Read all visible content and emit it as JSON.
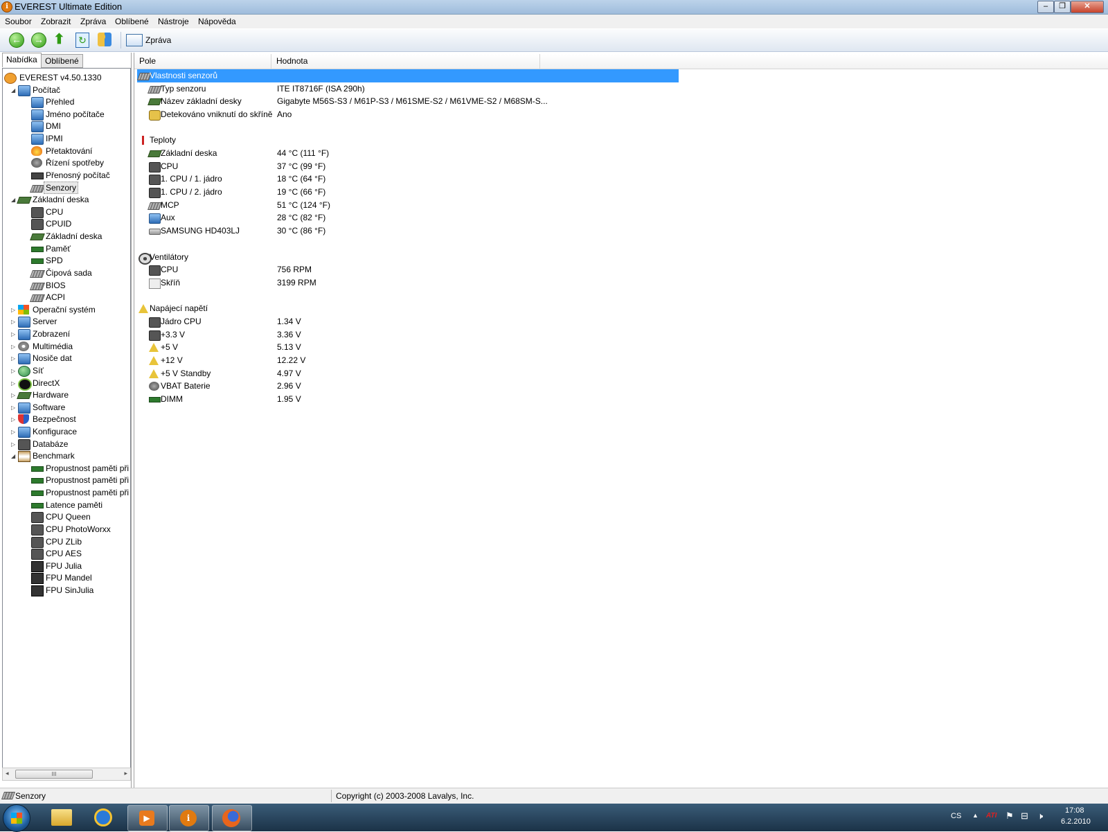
{
  "window": {
    "title": "EVEREST Ultimate Edition",
    "title_icon": "info-icon",
    "controls": [
      "minimize",
      "maximize",
      "close"
    ]
  },
  "menu": [
    "Soubor",
    "Zobrazit",
    "Zpráva",
    "Oblíbené",
    "Nástroje",
    "Nápověda"
  ],
  "toolbar": {
    "buttons": [
      "back-icon",
      "forward-icon",
      "up-icon",
      "refresh-icon",
      "users-icon"
    ],
    "report_label": "Zpráva"
  },
  "left_tabs": [
    "Nabídka",
    "Oblíbené"
  ],
  "tree": [
    {
      "label": "EVEREST v4.50.1330",
      "level": 0,
      "icon": "info-icon",
      "expander": ""
    },
    {
      "label": "Počítač",
      "level": 1,
      "icon": "computer-icon",
      "expander": "◢"
    },
    {
      "label": "Přehled",
      "level": 2,
      "icon": "computer-icon",
      "expander": ""
    },
    {
      "label": "Jméno počítače",
      "level": 2,
      "icon": "computer-icon",
      "expander": ""
    },
    {
      "label": "DMI",
      "level": 2,
      "icon": "computer-icon",
      "expander": ""
    },
    {
      "label": "IPMI",
      "level": 2,
      "icon": "computer-icon",
      "expander": ""
    },
    {
      "label": "Přetaktování",
      "level": 2,
      "icon": "fire-icon",
      "expander": ""
    },
    {
      "label": "Řízení spotřeby",
      "level": 2,
      "icon": "power-icon",
      "expander": ""
    },
    {
      "label": "Přenosný počítač",
      "level": 2,
      "icon": "laptop-icon",
      "expander": ""
    },
    {
      "label": "Senzory",
      "level": 2,
      "icon": "sensor-icon",
      "expander": "",
      "selected": true
    },
    {
      "label": "Základní deska",
      "level": 1,
      "icon": "motherboard-icon",
      "expander": "◢"
    },
    {
      "label": "CPU",
      "level": 2,
      "icon": "cpu-icon",
      "expander": ""
    },
    {
      "label": "CPUID",
      "level": 2,
      "icon": "cpu-icon",
      "expander": ""
    },
    {
      "label": "Základní deska",
      "level": 2,
      "icon": "motherboard-icon",
      "expander": ""
    },
    {
      "label": "Paměť",
      "level": 2,
      "icon": "memory-icon",
      "expander": ""
    },
    {
      "label": "SPD",
      "level": 2,
      "icon": "memory-icon",
      "expander": ""
    },
    {
      "label": "Čipová sada",
      "level": 2,
      "icon": "chipset-icon",
      "expander": ""
    },
    {
      "label": "BIOS",
      "level": 2,
      "icon": "chipset-icon",
      "expander": ""
    },
    {
      "label": "ACPI",
      "level": 2,
      "icon": "chipset-icon",
      "expander": ""
    },
    {
      "label": "Operační systém",
      "level": 1,
      "icon": "windows-icon",
      "expander": "▷"
    },
    {
      "label": "Server",
      "level": 1,
      "icon": "server-icon",
      "expander": "▷"
    },
    {
      "label": "Zobrazení",
      "level": 1,
      "icon": "display-icon",
      "expander": "▷"
    },
    {
      "label": "Multimédia",
      "level": 1,
      "icon": "multimedia-icon",
      "expander": "▷"
    },
    {
      "label": "Nosiče dat",
      "level": 1,
      "icon": "storage-icon",
      "expander": "▷"
    },
    {
      "label": "Síť",
      "level": 1,
      "icon": "network-icon",
      "expander": "▷"
    },
    {
      "label": "DirectX",
      "level": 1,
      "icon": "directx-icon",
      "expander": "▷"
    },
    {
      "label": "Hardware",
      "level": 1,
      "icon": "hardware-icon",
      "expander": "▷"
    },
    {
      "label": "Software",
      "level": 1,
      "icon": "software-icon",
      "expander": "▷"
    },
    {
      "label": "Bezpečnost",
      "level": 1,
      "icon": "security-icon",
      "expander": "▷"
    },
    {
      "label": "Konfigurace",
      "level": 1,
      "icon": "config-icon",
      "expander": "▷"
    },
    {
      "label": "Databáze",
      "level": 1,
      "icon": "database-icon",
      "expander": "▷"
    },
    {
      "label": "Benchmark",
      "level": 1,
      "icon": "benchmark-icon",
      "expander": "◢"
    },
    {
      "label": "Propustnost paměti při",
      "level": 2,
      "icon": "memory-icon",
      "expander": ""
    },
    {
      "label": "Propustnost paměti při",
      "level": 2,
      "icon": "memory-icon",
      "expander": ""
    },
    {
      "label": "Propustnost paměti při",
      "level": 2,
      "icon": "memory-icon",
      "expander": ""
    },
    {
      "label": "Latence paměti",
      "level": 2,
      "icon": "memory-icon",
      "expander": ""
    },
    {
      "label": "CPU Queen",
      "level": 2,
      "icon": "cpu-icon",
      "expander": ""
    },
    {
      "label": "CPU PhotoWorxx",
      "level": 2,
      "icon": "cpu-icon",
      "expander": ""
    },
    {
      "label": "CPU ZLib",
      "level": 2,
      "icon": "cpu-icon",
      "expander": ""
    },
    {
      "label": "CPU AES",
      "level": 2,
      "icon": "cpu-icon",
      "expander": ""
    },
    {
      "label": "FPU Julia",
      "level": 2,
      "icon": "fpu-icon",
      "expander": ""
    },
    {
      "label": "FPU Mandel",
      "level": 2,
      "icon": "fpu-icon",
      "expander": ""
    },
    {
      "label": "FPU SinJulia",
      "level": 2,
      "icon": "fpu-icon",
      "expander": ""
    }
  ],
  "tree_scroll_thumb": "III",
  "columns": [
    "Pole",
    "Hodnota"
  ],
  "rows": [
    {
      "field": "Vlastnosti senzorů",
      "value": "",
      "kind": "header",
      "icon": "sensor-icon",
      "selected": true
    },
    {
      "field": "Typ senzoru",
      "value": "ITE IT8716F  (ISA 290h)",
      "kind": "item",
      "icon": "sensor-icon"
    },
    {
      "field": "Název základní desky",
      "value": "Gigabyte M56S-S3 / M61P-S3 / M61SME-S2 / M61VME-S2 / M68SM-S...",
      "kind": "item",
      "icon": "motherboard-icon"
    },
    {
      "field": "Detekováno vniknutí do skříně",
      "value": "Ano",
      "kind": "item",
      "icon": "lock-icon"
    },
    {
      "field": "",
      "value": "",
      "kind": "blank"
    },
    {
      "field": "Teploty",
      "value": "",
      "kind": "header",
      "icon": "thermometer-icon"
    },
    {
      "field": "Základní deska",
      "value": "44 °C  (111 °F)",
      "kind": "item",
      "icon": "motherboard-icon"
    },
    {
      "field": "CPU",
      "value": "37 °C  (99 °F)",
      "kind": "item",
      "icon": "cpu-icon"
    },
    {
      "field": "1. CPU / 1. jádro",
      "value": "18 °C  (64 °F)",
      "kind": "item",
      "icon": "cpu-icon"
    },
    {
      "field": "1. CPU / 2. jádro",
      "value": "19 °C  (66 °F)",
      "kind": "item",
      "icon": "cpu-icon"
    },
    {
      "field": "MCP",
      "value": "51 °C  (124 °F)",
      "kind": "item",
      "icon": "chipset-icon"
    },
    {
      "field": "Aux",
      "value": "28 °C  (82 °F)",
      "kind": "item",
      "icon": "computer-icon"
    },
    {
      "field": "SAMSUNG HD403LJ",
      "value": "30 °C  (86 °F)",
      "kind": "item",
      "icon": "hdd-icon"
    },
    {
      "field": "",
      "value": "",
      "kind": "blank"
    },
    {
      "field": "Ventilátory",
      "value": "",
      "kind": "header",
      "icon": "fan-icon"
    },
    {
      "field": "CPU",
      "value": "756 RPM",
      "kind": "item",
      "icon": "cpu-icon"
    },
    {
      "field": "Skříň",
      "value": "3199 RPM",
      "kind": "item",
      "icon": "case-icon"
    },
    {
      "field": "",
      "value": "",
      "kind": "blank"
    },
    {
      "field": "Napájecí napětí",
      "value": "",
      "kind": "header",
      "icon": "voltage-icon"
    },
    {
      "field": "Jádro CPU",
      "value": "1.34 V",
      "kind": "item",
      "icon": "cpu-icon"
    },
    {
      "field": "+3.3 V",
      "value": "3.36 V",
      "kind": "item",
      "icon": "cpu-icon"
    },
    {
      "field": "+5 V",
      "value": "5.13 V",
      "kind": "item",
      "icon": "voltage-icon"
    },
    {
      "field": "+12 V",
      "value": "12.22 V",
      "kind": "item",
      "icon": "voltage-icon"
    },
    {
      "field": "+5 V Standby",
      "value": "4.97 V",
      "kind": "item",
      "icon": "voltage-icon"
    },
    {
      "field": "VBAT Baterie",
      "value": "2.96 V",
      "kind": "item",
      "icon": "battery-icon"
    },
    {
      "field": "DIMM",
      "value": "1.95 V",
      "kind": "item",
      "icon": "memory-icon"
    }
  ],
  "status": {
    "left": "Senzory",
    "right": "Copyright (c) 2003-2008 Lavalys, Inc."
  },
  "taskbar": {
    "apps": [
      "explorer-icon",
      "internet-explorer-icon",
      "media-player-icon",
      "everest-icon",
      "firefox-icon"
    ],
    "language": "CS",
    "time": "17:08",
    "date": "6.2.2010",
    "tray_icons": [
      "show-hidden-icon",
      "ati-icon",
      "flag-icon",
      "network-tray-icon",
      "volume-icon"
    ],
    "ati_label": "ATI"
  },
  "colors": {
    "selection": "#3399ff",
    "title_gradient_top": "#bcd3ea",
    "taskbar": "#1b3247"
  }
}
